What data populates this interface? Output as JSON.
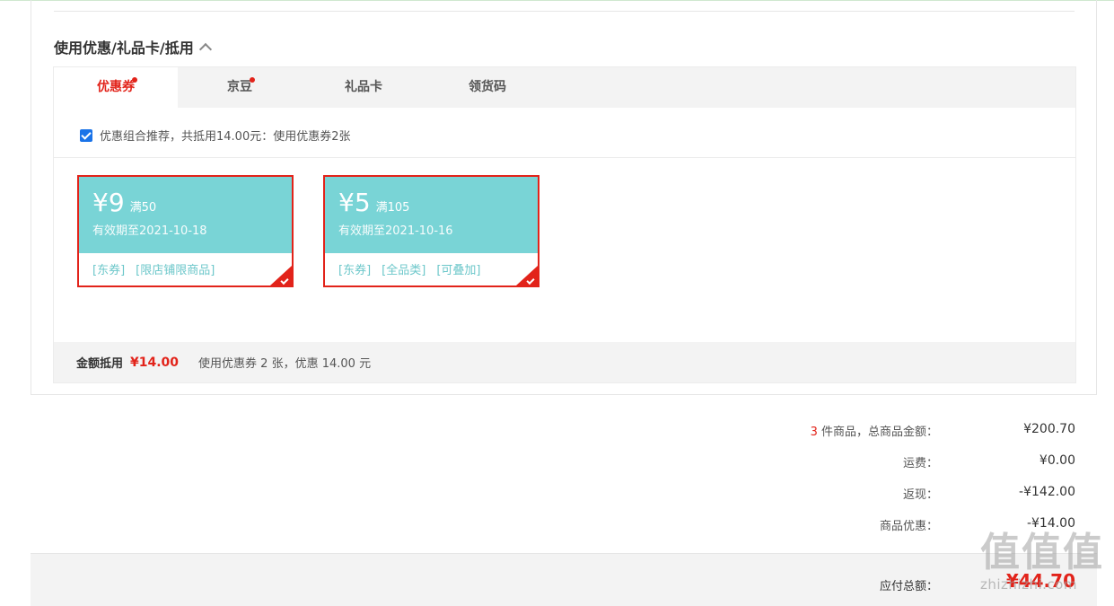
{
  "section": {
    "title": "使用优惠/礼品卡/抵用"
  },
  "tabs": [
    {
      "label": "优惠券",
      "active": true,
      "dot": true
    },
    {
      "label": "京豆",
      "active": false,
      "dot": true
    },
    {
      "label": "礼品卡",
      "active": false,
      "dot": false
    },
    {
      "label": "领货码",
      "active": false,
      "dot": false
    }
  ],
  "recommend": {
    "checked": true,
    "text": "优惠组合推荐，共抵用14.00元：使用优惠券2张"
  },
  "coupons": [
    {
      "amount": "¥9",
      "condition": "满50",
      "expiry": "有效期至2021-10-18",
      "tags": [
        "[东券]",
        "[限店铺限商品]"
      ],
      "selected": true
    },
    {
      "amount": "¥5",
      "condition": "满105",
      "expiry": "有效期至2021-10-16",
      "tags": [
        "[东券]",
        "[全品类]",
        "[可叠加]"
      ],
      "selected": true
    }
  ],
  "summary": {
    "label": "金额抵用",
    "amount": "¥14.00",
    "desc": "使用优惠券 2 张，优惠 14.00 元"
  },
  "totals": {
    "item_count": "3",
    "item_label": " 件商品，总商品金额：",
    "item_value": "¥200.70",
    "shipping_label": "运费：",
    "shipping_value": "¥0.00",
    "cashback_label": "返现：",
    "cashback_value": "-¥142.00",
    "discount_label": "商品优惠：",
    "discount_value": "-¥14.00"
  },
  "pay": {
    "label": "应付总额：",
    "amount": "¥44.70"
  },
  "watermark": {
    "glyphs": "值值值",
    "text": "zhizhizhi.com"
  },
  "colors": {
    "accent_red": "#e2231a",
    "coupon_teal": "#79d4d6",
    "checkbox_blue": "#1a73e8"
  }
}
